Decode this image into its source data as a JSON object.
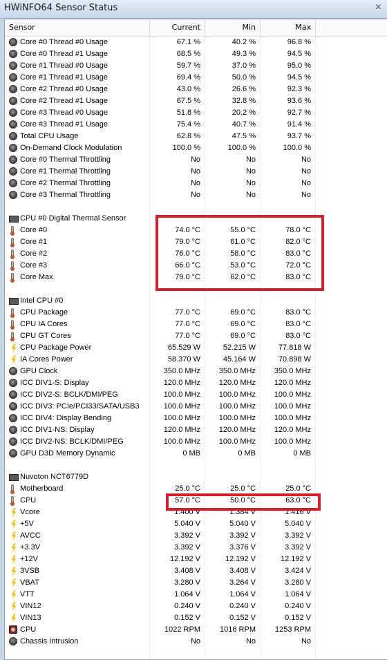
{
  "window": {
    "title": "HWiNFO64 Sensor Status"
  },
  "header": {
    "sensor": "Sensor",
    "current": "Current",
    "min": "Min",
    "max": "Max"
  },
  "colors": {
    "highlight": "#d3202f"
  },
  "groups": [
    {
      "name": null,
      "rows": [
        {
          "icon": "gauge-icon",
          "name": "Core #0 Thread #0 Usage",
          "cur": "67.1 %",
          "min": "40.2 %",
          "max": "96.8 %"
        },
        {
          "icon": "gauge-icon",
          "name": "Core #0 Thread #1 Usage",
          "cur": "68.5 %",
          "min": "49.3 %",
          "max": "94.5 %"
        },
        {
          "icon": "gauge-icon",
          "name": "Core #1 Thread #0 Usage",
          "cur": "59.7 %",
          "min": "37.0 %",
          "max": "95.0 %"
        },
        {
          "icon": "gauge-icon",
          "name": "Core #1 Thread #1 Usage",
          "cur": "69.4 %",
          "min": "50.0 %",
          "max": "94.5 %"
        },
        {
          "icon": "gauge-icon",
          "name": "Core #2 Thread #0 Usage",
          "cur": "43.0 %",
          "min": "26.6 %",
          "max": "92.3 %"
        },
        {
          "icon": "gauge-icon",
          "name": "Core #2 Thread #1 Usage",
          "cur": "67.5 %",
          "min": "32.8 %",
          "max": "93.6 %"
        },
        {
          "icon": "gauge-icon",
          "name": "Core #3 Thread #0 Usage",
          "cur": "51.8 %",
          "min": "20.2 %",
          "max": "92.7 %"
        },
        {
          "icon": "gauge-icon",
          "name": "Core #3 Thread #1 Usage",
          "cur": "75.4 %",
          "min": "40.7 %",
          "max": "91.4 %"
        },
        {
          "icon": "gauge-icon",
          "name": "Total CPU Usage",
          "cur": "62.8 %",
          "min": "47.5 %",
          "max": "93.7 %"
        },
        {
          "icon": "gauge-icon",
          "name": "On-Demand Clock Modulation",
          "cur": "100.0 %",
          "min": "100.0 %",
          "max": "100.0 %"
        },
        {
          "icon": "gauge-icon",
          "name": "Core #0 Thermal Throttling",
          "cur": "No",
          "min": "No",
          "max": "No"
        },
        {
          "icon": "gauge-icon",
          "name": "Core #1 Thermal Throttling",
          "cur": "No",
          "min": "No",
          "max": "No"
        },
        {
          "icon": "gauge-icon",
          "name": "Core #2 Thermal Throttling",
          "cur": "No",
          "min": "No",
          "max": "No"
        },
        {
          "icon": "gauge-icon",
          "name": "Core #3 Thermal Throttling",
          "cur": "No",
          "min": "No",
          "max": "No"
        }
      ]
    },
    {
      "name": "CPU #0 Digital Thermal Sensor",
      "rows": [
        {
          "icon": "thermometer-icon",
          "name": "Core #0",
          "cur": "74.0 °C",
          "min": "55.0 °C",
          "max": "78.0 °C"
        },
        {
          "icon": "thermometer-icon",
          "name": "Core #1",
          "cur": "79.0 °C",
          "min": "61.0 °C",
          "max": "82.0 °C"
        },
        {
          "icon": "thermometer-icon",
          "name": "Core #2",
          "cur": "76.0 °C",
          "min": "58.0 °C",
          "max": "83.0 °C"
        },
        {
          "icon": "thermometer-icon",
          "name": "Core #3",
          "cur": "66.0 °C",
          "min": "53.0 °C",
          "max": "72.0 °C"
        },
        {
          "icon": "thermometer-icon",
          "name": "Core Max",
          "cur": "79.0 °C",
          "min": "62.0 °C",
          "max": "83.0 °C"
        }
      ]
    },
    {
      "name": "Intel CPU #0",
      "rows": [
        {
          "icon": "thermometer-icon",
          "name": "CPU Package",
          "cur": "77.0 °C",
          "min": "69.0 °C",
          "max": "83.0 °C"
        },
        {
          "icon": "thermometer-icon",
          "name": "CPU IA Cores",
          "cur": "77.0 °C",
          "min": "69.0 °C",
          "max": "83.0 °C"
        },
        {
          "icon": "thermometer-icon",
          "name": "CPU GT Cores",
          "cur": "77.0 °C",
          "min": "69.0 °C",
          "max": "83.0 °C"
        },
        {
          "icon": "bolt-icon",
          "name": "CPU Package Power",
          "cur": "65.529 W",
          "min": "52.215 W",
          "max": "77.818 W"
        },
        {
          "icon": "bolt-icon",
          "name": "IA Cores Power",
          "cur": "58.370 W",
          "min": "45.164 W",
          "max": "70.898 W"
        },
        {
          "icon": "gauge-icon",
          "name": "GPU Clock",
          "cur": "350.0 MHz",
          "min": "350.0 MHz",
          "max": "350.0 MHz"
        },
        {
          "icon": "gauge-icon",
          "name": "ICC DIV1-S: Display",
          "cur": "120.0 MHz",
          "min": "120.0 MHz",
          "max": "120.0 MHz"
        },
        {
          "icon": "gauge-icon",
          "name": "ICC DIV2-S: BCLK/DMI/PEG",
          "cur": "100.0 MHz",
          "min": "100.0 MHz",
          "max": "100.0 MHz"
        },
        {
          "icon": "gauge-icon",
          "name": "ICC DIV3: PCIe/PCI33/SATA/USB3",
          "cur": "100.0 MHz",
          "min": "100.0 MHz",
          "max": "100.0 MHz"
        },
        {
          "icon": "gauge-icon",
          "name": "ICC DIV4: Display Bending",
          "cur": "100.0 MHz",
          "min": "100.0 MHz",
          "max": "100.0 MHz"
        },
        {
          "icon": "gauge-icon",
          "name": "ICC DIV1-NS: Display",
          "cur": "120.0 MHz",
          "min": "120.0 MHz",
          "max": "120.0 MHz"
        },
        {
          "icon": "gauge-icon",
          "name": "ICC DIV2-NS: BCLK/DMI/PEG",
          "cur": "100.0 MHz",
          "min": "100.0 MHz",
          "max": "100.0 MHz"
        },
        {
          "icon": "gauge-icon",
          "name": "GPU D3D Memory Dynamic",
          "cur": "0 MB",
          "min": "0 MB",
          "max": "0 MB"
        }
      ]
    },
    {
      "name": "Nuvoton NCT6779D",
      "rows": [
        {
          "icon": "thermometer-icon",
          "name": "Motherboard",
          "cur": "25.0 °C",
          "min": "25.0 °C",
          "max": "25.0 °C"
        },
        {
          "icon": "thermometer-icon",
          "name": "CPU",
          "cur": "57.0 °C",
          "min": "50.0 °C",
          "max": "63.0 °C"
        },
        {
          "icon": "bolt-icon",
          "name": "Vcore",
          "cur": "1.400 V",
          "min": "1.384 V",
          "max": "1.416 V"
        },
        {
          "icon": "bolt-icon",
          "name": "+5V",
          "cur": "5.040 V",
          "min": "5.040 V",
          "max": "5.040 V"
        },
        {
          "icon": "bolt-icon",
          "name": "AVCC",
          "cur": "3.392 V",
          "min": "3.392 V",
          "max": "3.392 V"
        },
        {
          "icon": "bolt-icon",
          "name": "+3.3V",
          "cur": "3.392 V",
          "min": "3.376 V",
          "max": "3.392 V"
        },
        {
          "icon": "bolt-icon",
          "name": "+12V",
          "cur": "12.192 V",
          "min": "12.192 V",
          "max": "12.192 V"
        },
        {
          "icon": "bolt-icon",
          "name": "3VSB",
          "cur": "3.408 V",
          "min": "3.408 V",
          "max": "3.424 V"
        },
        {
          "icon": "bolt-icon",
          "name": "VBAT",
          "cur": "3.280 V",
          "min": "3.264 V",
          "max": "3.280 V"
        },
        {
          "icon": "bolt-icon",
          "name": "VTT",
          "cur": "1.064 V",
          "min": "1.064 V",
          "max": "1.064 V"
        },
        {
          "icon": "bolt-icon",
          "name": "VIN12",
          "cur": "0.240 V",
          "min": "0.240 V",
          "max": "0.240 V"
        },
        {
          "icon": "bolt-icon",
          "name": "VIN13",
          "cur": "0.152 V",
          "min": "0.152 V",
          "max": "0.152 V"
        },
        {
          "icon": "fan-icon",
          "name": "CPU",
          "cur": "1022 RPM",
          "min": "1016 RPM",
          "max": "1253 RPM"
        },
        {
          "icon": "gauge-icon",
          "name": "Chassis Intrusion",
          "cur": "No",
          "min": "No",
          "max": "No"
        }
      ]
    }
  ]
}
